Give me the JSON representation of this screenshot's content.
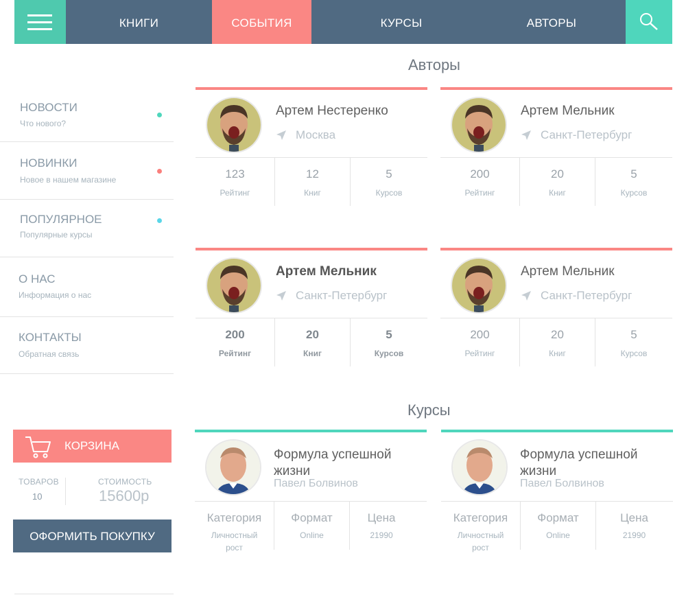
{
  "nav": {
    "items": [
      {
        "label": "КНИГИ"
      },
      {
        "label": "СОБЫТИЯ"
      },
      {
        "label": "КУРСЫ"
      },
      {
        "label": "АВТОРЫ"
      }
    ],
    "active": "СОБЫТИЯ",
    "menu_icon": "hamburger-icon",
    "search_icon": "search-icon"
  },
  "sidebar": {
    "items": [
      {
        "title": "НОВОСТИ",
        "sub": "Что нового?",
        "dot_color": "#4fd6bc"
      },
      {
        "title": "НОВИНКИ",
        "sub": "Новое в нашем магазине",
        "dot_color": "#fa7f7c"
      },
      {
        "title": "ПОПУЛЯРНОЕ",
        "sub": "Популярные курсы",
        "dot_color": "#5ad6e8"
      },
      {
        "title": "О НАС",
        "sub": "Информация о нас"
      },
      {
        "title": "КОНТАКТЫ",
        "sub": "Обратная связь"
      }
    ]
  },
  "cart": {
    "label": "КОРЗИНА",
    "icon": "cart-icon",
    "items_label": "ТОВАРОВ",
    "items_value": "10",
    "cost_label": "СТОИМОСТЬ",
    "cost_value": "15600р",
    "checkout_label": "ОФОРМИТЬ ПОКУПКУ"
  },
  "authors": {
    "title": "Авторы",
    "cards": [
      {
        "name": "Артем Нестеренко",
        "city": "Москва",
        "rating": "123",
        "books": "12",
        "courses": "5"
      },
      {
        "name": "Артем Мельник",
        "city": "Санкт-Петербург",
        "rating": "200",
        "books": "20",
        "courses": "5"
      },
      {
        "name": "Артем Мельник",
        "city": "Санкт-Петербург",
        "rating": "200",
        "books": "20",
        "courses": "5"
      },
      {
        "name": "Артем Мельник",
        "city": "Санкт-Петербург",
        "rating": "200",
        "books": "20",
        "courses": "5"
      }
    ],
    "stat_labels": {
      "rating": "Рейтинг",
      "books": "Книг",
      "courses": "Курсов"
    }
  },
  "courses": {
    "title": "Курсы",
    "cards": [
      {
        "name": "Формула успешной жизни",
        "author": "Павел Болвинов",
        "category": "Личностный рост",
        "format": "Online",
        "price": "21990"
      },
      {
        "name": "Формула успешной жизни",
        "author": "Павел Болвинов",
        "category": "Личностный рост",
        "format": "Online",
        "price": "21990"
      }
    ],
    "stat_labels": {
      "category": "Категория",
      "format": "Формат",
      "price": "Цена"
    }
  },
  "colors": {
    "nav_bg": "#506a82",
    "accent_green": "#4fd6bc",
    "accent_coral": "#fa8784"
  }
}
